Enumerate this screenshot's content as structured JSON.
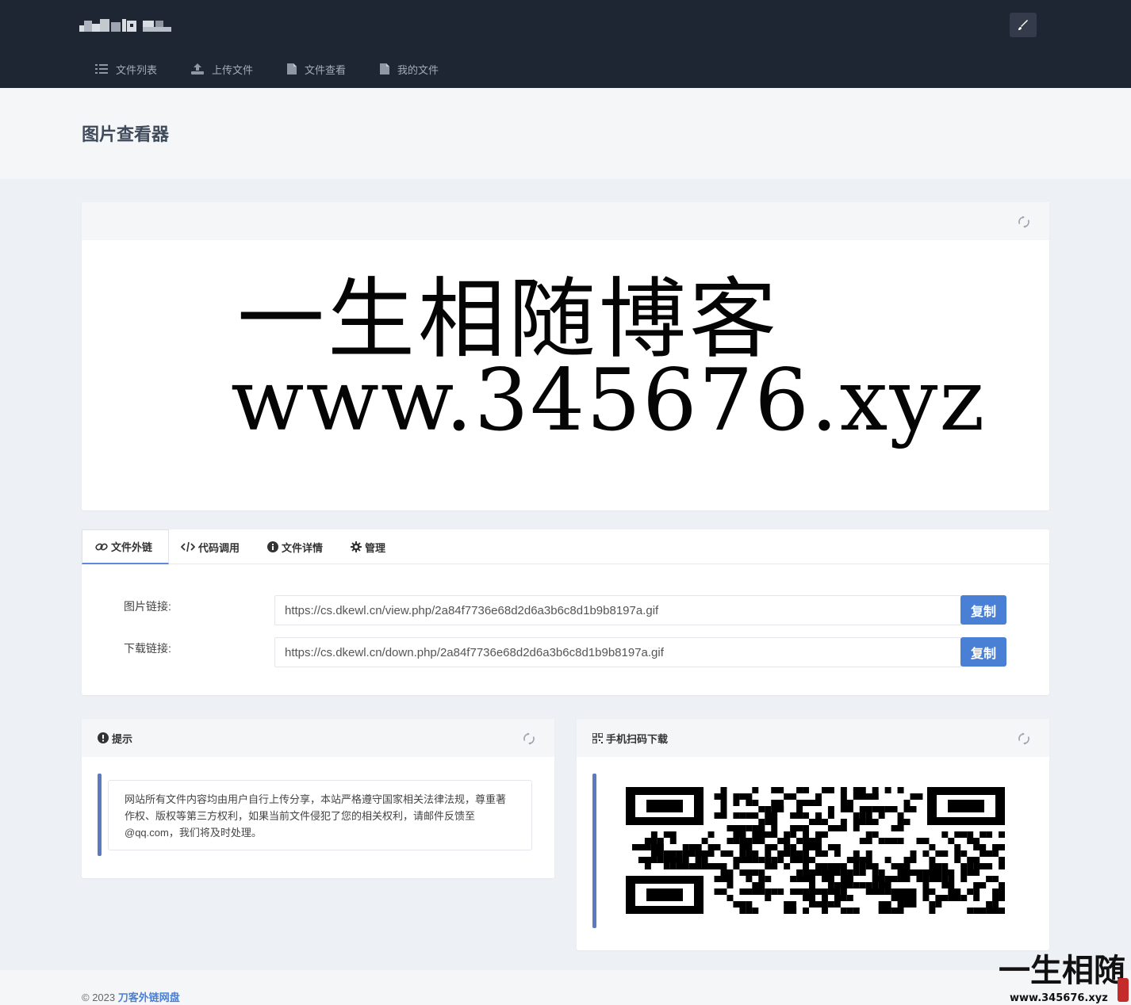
{
  "nav": {
    "items": [
      {
        "label": "文件列表",
        "icon": "list-icon"
      },
      {
        "label": "上传文件",
        "icon": "upload-icon"
      },
      {
        "label": "文件查看",
        "icon": "file-icon"
      },
      {
        "label": "我的文件",
        "icon": "file-icon"
      }
    ]
  },
  "header": {
    "title": "图片查看器"
  },
  "preview": {
    "line1": "一生相随博客",
    "line2": "www.345676.xyz"
  },
  "tabs": [
    {
      "label": "文件外链",
      "icon": "link-icon"
    },
    {
      "label": "代码调用",
      "icon": "code-icon"
    },
    {
      "label": "文件详情",
      "icon": "info-icon"
    },
    {
      "label": "管理",
      "icon": "gear-icon"
    }
  ],
  "links": [
    {
      "label": "图片链接:",
      "url": "https://cs.dkewl.cn/view.php/2a84f7736e68d2d6a3b6c8d1b9b8197a.gif",
      "button": "复制"
    },
    {
      "label": "下载链接:",
      "url": "https://cs.dkewl.cn/down.php/2a84f7736e68d2d6a3b6c8d1b9b8197a.gif",
      "button": "复制"
    }
  ],
  "notice": {
    "title": "提示",
    "text": "网站所有文件内容均由用户自行上传分享，本站严格遵守国家相关法律法规，尊重著作权、版权等第三方权利，如果当前文件侵犯了您的相关权利，请邮件反馈至@qq.com，我们将及时处理。"
  },
  "qr_card": {
    "title": "手机扫码下载"
  },
  "footer": {
    "prefix": "© 2023",
    "site": "刀客外链网盘"
  },
  "corner_watermark": {
    "name": "一生相随",
    "url": "www.345676.xyz"
  },
  "colors": {
    "topbar": "#1f2633",
    "accent": "#4a7fd6",
    "notice_bar": "#5a7bbd"
  }
}
